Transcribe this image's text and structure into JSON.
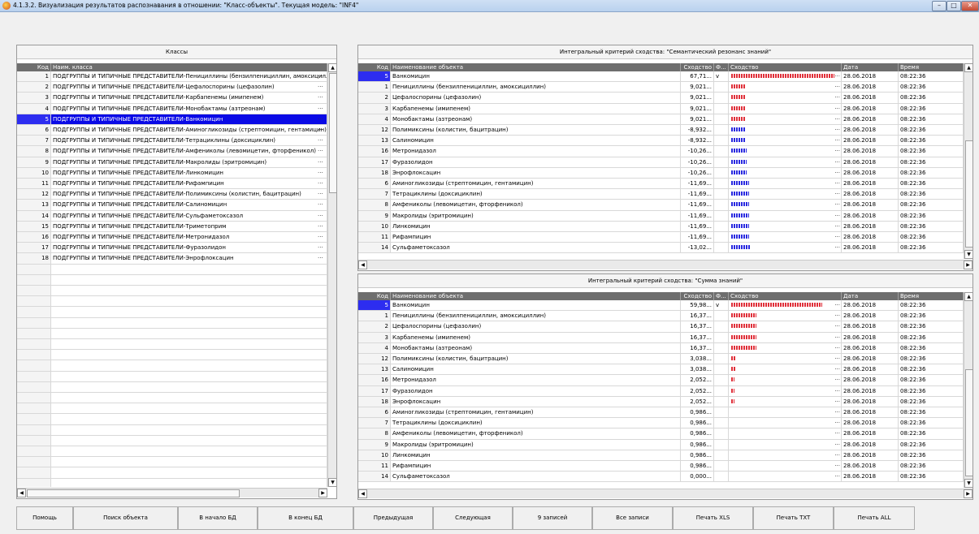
{
  "window": {
    "title": "4.1.3.2. Визуализация результатов распознавания в отношении: \"Класс-объекты\". Текущая модель: \"INF4\"",
    "min_glyph": "–",
    "max_glyph": "□",
    "close_glyph": "✕"
  },
  "left": {
    "title": "Классы",
    "col_code": "Код",
    "col_name": "Наим. класса",
    "selected_code": "5",
    "rows": [
      {
        "code": "1",
        "name": "ПОДГРУППЫ И ТИПИЧНЫЕ ПРЕДСТАВИТЕЛИ-Пенициллины (бензилпенициллин, амоксициллин)"
      },
      {
        "code": "2",
        "name": "ПОДГРУППЫ И ТИПИЧНЫЕ ПРЕДСТАВИТЕЛИ-Цефалоспорины (цефазолин)"
      },
      {
        "code": "3",
        "name": "ПОДГРУППЫ И ТИПИЧНЫЕ ПРЕДСТАВИТЕЛИ-Карбапенемы (имипенем)"
      },
      {
        "code": "4",
        "name": "ПОДГРУППЫ И ТИПИЧНЫЕ ПРЕДСТАВИТЕЛИ-Монобактамы (азтреонам)"
      },
      {
        "code": "5",
        "name": "ПОДГРУППЫ И ТИПИЧНЫЕ ПРЕДСТАВИТЕЛИ-Ванкомицин"
      },
      {
        "code": "6",
        "name": "ПОДГРУППЫ И ТИПИЧНЫЕ ПРЕДСТАВИТЕЛИ-Аминогликозиды (стрептомицин, гентамицин)"
      },
      {
        "code": "7",
        "name": "ПОДГРУППЫ И ТИПИЧНЫЕ ПРЕДСТАВИТЕЛИ-Тетрациклины (доксициклин)"
      },
      {
        "code": "8",
        "name": "ПОДГРУППЫ И ТИПИЧНЫЕ ПРЕДСТАВИТЕЛИ-Амфениколы (левомицетин, фторфеникол)"
      },
      {
        "code": "9",
        "name": "ПОДГРУППЫ И ТИПИЧНЫЕ ПРЕДСТАВИТЕЛИ-Макролиды (эритромицин)"
      },
      {
        "code": "10",
        "name": "ПОДГРУППЫ И ТИПИЧНЫЕ ПРЕДСТАВИТЕЛИ-Линкомицин"
      },
      {
        "code": "11",
        "name": "ПОДГРУППЫ И ТИПИЧНЫЕ ПРЕДСТАВИТЕЛИ-Рифампицин"
      },
      {
        "code": "12",
        "name": "ПОДГРУППЫ И ТИПИЧНЫЕ ПРЕДСТАВИТЕЛИ-Полимиксины (колистин, бацитрацин)"
      },
      {
        "code": "13",
        "name": "ПОДГРУППЫ И ТИПИЧНЫЕ ПРЕДСТАВИТЕЛИ-Салиномицин"
      },
      {
        "code": "14",
        "name": "ПОДГРУППЫ И ТИПИЧНЫЕ ПРЕДСТАВИТЕЛИ-Сульфаметоксазол"
      },
      {
        "code": "15",
        "name": "ПОДГРУППЫ И ТИПИЧНЫЕ ПРЕДСТАВИТЕЛИ-Триметоприм"
      },
      {
        "code": "16",
        "name": "ПОДГРУППЫ И ТИПИЧНЫЕ ПРЕДСТАВИТЕЛИ-Метронидазол"
      },
      {
        "code": "17",
        "name": "ПОДГРУППЫ И ТИПИЧНЫЕ ПРЕДСТАВИТЕЛИ-Фуразолидон"
      },
      {
        "code": "18",
        "name": "ПОДГРУППЫ И ТИПИЧНЫЕ ПРЕДСТАВИТЕЛИ-Энрофлоксацин"
      }
    ]
  },
  "columns": {
    "code": "Код",
    "name": "Наименование объекта",
    "sim": "Сходство",
    "f": "Ф...",
    "simbar": "Сходство",
    "date": "Дата",
    "time": "Время"
  },
  "top_grid": {
    "title": "Интегральный критерий сходства: \"Семантический резонанс знаний\"",
    "rows": [
      {
        "code": "5",
        "name": "Ванкомицин",
        "sim": "67,71...",
        "f": "v",
        "level": 0.6771,
        "sign": "pos",
        "date": "28.06.2018",
        "time": "08:22:36",
        "selected": true
      },
      {
        "code": "1",
        "name": "Пенициллины (бензилпенициллин, амоксициллин)",
        "sim": "9,021...",
        "f": "",
        "level": 0.09,
        "sign": "pos",
        "date": "28.06.2018",
        "time": "08:22:36"
      },
      {
        "code": "2",
        "name": "Цефалоспорины (цефазолин)",
        "sim": "9,021...",
        "f": "",
        "level": 0.09,
        "sign": "pos",
        "date": "28.06.2018",
        "time": "08:22:36"
      },
      {
        "code": "3",
        "name": "Карбапенемы (имипенем)",
        "sim": "9,021...",
        "f": "",
        "level": 0.09,
        "sign": "pos",
        "date": "28.06.2018",
        "time": "08:22:36"
      },
      {
        "code": "4",
        "name": "Монобактамы (азтреонам)",
        "sim": "9,021...",
        "f": "",
        "level": 0.09,
        "sign": "pos",
        "date": "28.06.2018",
        "time": "08:22:36"
      },
      {
        "code": "12",
        "name": "Полимиксины (колистин, бацитрацин)",
        "sim": "-8,932...",
        "f": "",
        "level": 0.089,
        "sign": "neg",
        "date": "28.06.2018",
        "time": "08:22:36"
      },
      {
        "code": "13",
        "name": "Салиномицин",
        "sim": "-8,932...",
        "f": "",
        "level": 0.089,
        "sign": "neg",
        "date": "28.06.2018",
        "time": "08:22:36"
      },
      {
        "code": "16",
        "name": "Метронидазол",
        "sim": "-10,26...",
        "f": "",
        "level": 0.1026,
        "sign": "neg",
        "date": "28.06.2018",
        "time": "08:22:36"
      },
      {
        "code": "17",
        "name": "Фуразолидон",
        "sim": "-10,26...",
        "f": "",
        "level": 0.1026,
        "sign": "neg",
        "date": "28.06.2018",
        "time": "08:22:36"
      },
      {
        "code": "18",
        "name": "Энрофлоксацин",
        "sim": "-10,26...",
        "f": "",
        "level": 0.1026,
        "sign": "neg",
        "date": "28.06.2018",
        "time": "08:22:36"
      },
      {
        "code": "6",
        "name": "Аминогликозиды (стрептомицин, гентамицин)",
        "sim": "-11,69...",
        "f": "",
        "level": 0.1169,
        "sign": "neg",
        "date": "28.06.2018",
        "time": "08:22:36"
      },
      {
        "code": "7",
        "name": "Тетрациклины (доксициклин)",
        "sim": "-11,69...",
        "f": "",
        "level": 0.1169,
        "sign": "neg",
        "date": "28.06.2018",
        "time": "08:22:36"
      },
      {
        "code": "8",
        "name": "Амфениколы (левомицетин, фторфеникол)",
        "sim": "-11,69...",
        "f": "",
        "level": 0.1169,
        "sign": "neg",
        "date": "28.06.2018",
        "time": "08:22:36"
      },
      {
        "code": "9",
        "name": "Макролиды (эритромицин)",
        "sim": "-11,69...",
        "f": "",
        "level": 0.1169,
        "sign": "neg",
        "date": "28.06.2018",
        "time": "08:22:36"
      },
      {
        "code": "10",
        "name": "Линкомицин",
        "sim": "-11,69...",
        "f": "",
        "level": 0.1169,
        "sign": "neg",
        "date": "28.06.2018",
        "time": "08:22:36"
      },
      {
        "code": "11",
        "name": "Рифампицин",
        "sim": "-11,69...",
        "f": "",
        "level": 0.1169,
        "sign": "neg",
        "date": "28.06.2018",
        "time": "08:22:36"
      },
      {
        "code": "14",
        "name": "Сульфаметоксазол",
        "sim": "-13,02...",
        "f": "",
        "level": 0.1302,
        "sign": "neg",
        "date": "28.06.2018",
        "time": "08:22:36"
      }
    ]
  },
  "bottom_grid": {
    "title": "Интегральный критерий сходства: \"Сумма знаний\"",
    "rows": [
      {
        "code": "5",
        "name": "Ванкомицин",
        "sim": "59,98...",
        "f": "v",
        "level": 0.5998,
        "sign": "pos",
        "date": "28.06.2018",
        "time": "08:22:36",
        "selected": true
      },
      {
        "code": "1",
        "name": "Пенициллины (бензилпенициллин, амоксициллин)",
        "sim": "16,37...",
        "f": "",
        "level": 0.1637,
        "sign": "pos",
        "date": "28.06.2018",
        "time": "08:22:36"
      },
      {
        "code": "2",
        "name": "Цефалоспорины (цефазолин)",
        "sim": "16,37...",
        "f": "",
        "level": 0.1637,
        "sign": "pos",
        "date": "28.06.2018",
        "time": "08:22:36"
      },
      {
        "code": "3",
        "name": "Карбапенемы (имипенем)",
        "sim": "16,37...",
        "f": "",
        "level": 0.1637,
        "sign": "pos",
        "date": "28.06.2018",
        "time": "08:22:36"
      },
      {
        "code": "4",
        "name": "Монобактамы (азтреонам)",
        "sim": "16,37...",
        "f": "",
        "level": 0.1637,
        "sign": "pos",
        "date": "28.06.2018",
        "time": "08:22:36"
      },
      {
        "code": "12",
        "name": "Полимиксины (колистин, бацитрацин)",
        "sim": "3,038...",
        "f": "",
        "level": 0.03,
        "sign": "pos",
        "date": "28.06.2018",
        "time": "08:22:36"
      },
      {
        "code": "13",
        "name": "Салиномицин",
        "sim": "3,038...",
        "f": "",
        "level": 0.03,
        "sign": "pos",
        "date": "28.06.2018",
        "time": "08:22:36"
      },
      {
        "code": "16",
        "name": "Метронидазол",
        "sim": "2,052...",
        "f": "",
        "level": 0.02,
        "sign": "pos",
        "date": "28.06.2018",
        "time": "08:22:36"
      },
      {
        "code": "17",
        "name": "Фуразолидон",
        "sim": "2,052...",
        "f": "",
        "level": 0.02,
        "sign": "pos",
        "date": "28.06.2018",
        "time": "08:22:36"
      },
      {
        "code": "18",
        "name": "Энрофлоксацин",
        "sim": "2,052...",
        "f": "",
        "level": 0.02,
        "sign": "pos",
        "date": "28.06.2018",
        "time": "08:22:36"
      },
      {
        "code": "6",
        "name": "Аминогликозиды (стрептомицин, гентамицин)",
        "sim": "0,986...",
        "f": "",
        "level": 0,
        "sign": "pos",
        "date": "28.06.2018",
        "time": "08:22:36"
      },
      {
        "code": "7",
        "name": "Тетрациклины (доксициклин)",
        "sim": "0,986...",
        "f": "",
        "level": 0,
        "sign": "pos",
        "date": "28.06.2018",
        "time": "08:22:36"
      },
      {
        "code": "8",
        "name": "Амфениколы (левомицетин, фторфеникол)",
        "sim": "0,986...",
        "f": "",
        "level": 0,
        "sign": "pos",
        "date": "28.06.2018",
        "time": "08:22:36"
      },
      {
        "code": "9",
        "name": "Макролиды (эритромицин)",
        "sim": "0,986...",
        "f": "",
        "level": 0,
        "sign": "pos",
        "date": "28.06.2018",
        "time": "08:22:36"
      },
      {
        "code": "10",
        "name": "Линкомицин",
        "sim": "0,986...",
        "f": "",
        "level": 0,
        "sign": "pos",
        "date": "28.06.2018",
        "time": "08:22:36"
      },
      {
        "code": "11",
        "name": "Рифампицин",
        "sim": "0,986...",
        "f": "",
        "level": 0,
        "sign": "pos",
        "date": "28.06.2018",
        "time": "08:22:36"
      },
      {
        "code": "14",
        "name": "Сульфаметоксазол",
        "sim": "0,000...",
        "f": "",
        "level": 0,
        "sign": "pos",
        "date": "28.06.2018",
        "time": "08:22:36"
      }
    ]
  },
  "ellipsis": "...",
  "colors": {
    "positive_bar": "#e0303a",
    "negative_bar": "#2a2ae0",
    "selected_row": "#0a0ae6",
    "header_bg": "#6e6e6e"
  },
  "buttons": [
    {
      "label": "Помощь",
      "icon": ""
    },
    {
      "label": "Поиск объекта"
    },
    {
      "label": "В начало БД"
    },
    {
      "label": "В конец БД"
    },
    {
      "label": "Предыдущая"
    },
    {
      "label": "Следующая"
    },
    {
      "label": "9 записей"
    },
    {
      "label": "Все записи"
    },
    {
      "label": "Печать XLS"
    },
    {
      "label": "Печать TXT"
    },
    {
      "label": "Печать ALL"
    }
  ]
}
